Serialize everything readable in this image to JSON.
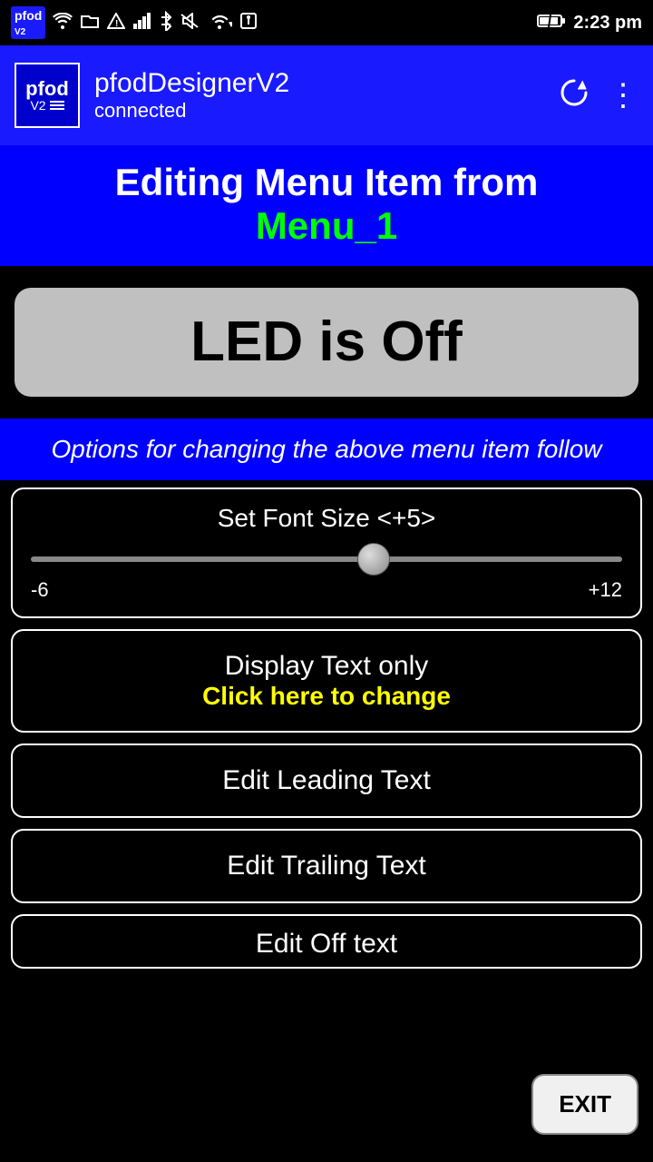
{
  "statusBar": {
    "time": "2:23 pm",
    "icons": [
      "wifi",
      "folder",
      "warning",
      "signal",
      "bluetooth",
      "mute",
      "wifi2",
      "usb",
      "battery"
    ]
  },
  "header": {
    "appName": "pfodDesignerV2",
    "logoText": "pfod",
    "logoV2": "V2",
    "connectionStatus": "connected",
    "refreshIcon": "↻",
    "menuIcon": "⋮"
  },
  "editingBanner": {
    "title": "Editing Menu Item from",
    "menuName": "Menu_1"
  },
  "ledButton": {
    "label": "LED is Off"
  },
  "optionsBanner": {
    "text": "Options for changing the above menu item follow"
  },
  "fontSizeControl": {
    "label": "Set Font Size <+5>",
    "minLabel": "-6",
    "maxLabel": "+12",
    "currentValue": 5,
    "sliderPosition": 58
  },
  "displayTextButton": {
    "mainText": "Display Text only",
    "subText": "Click here to change"
  },
  "editLeadingButton": {
    "label": "Edit Leading Text"
  },
  "editTrailingButton": {
    "label": "Edit Trailing Text"
  },
  "editOffButton": {
    "label": "Edit Off text"
  },
  "exitButton": {
    "label": "EXIT"
  }
}
